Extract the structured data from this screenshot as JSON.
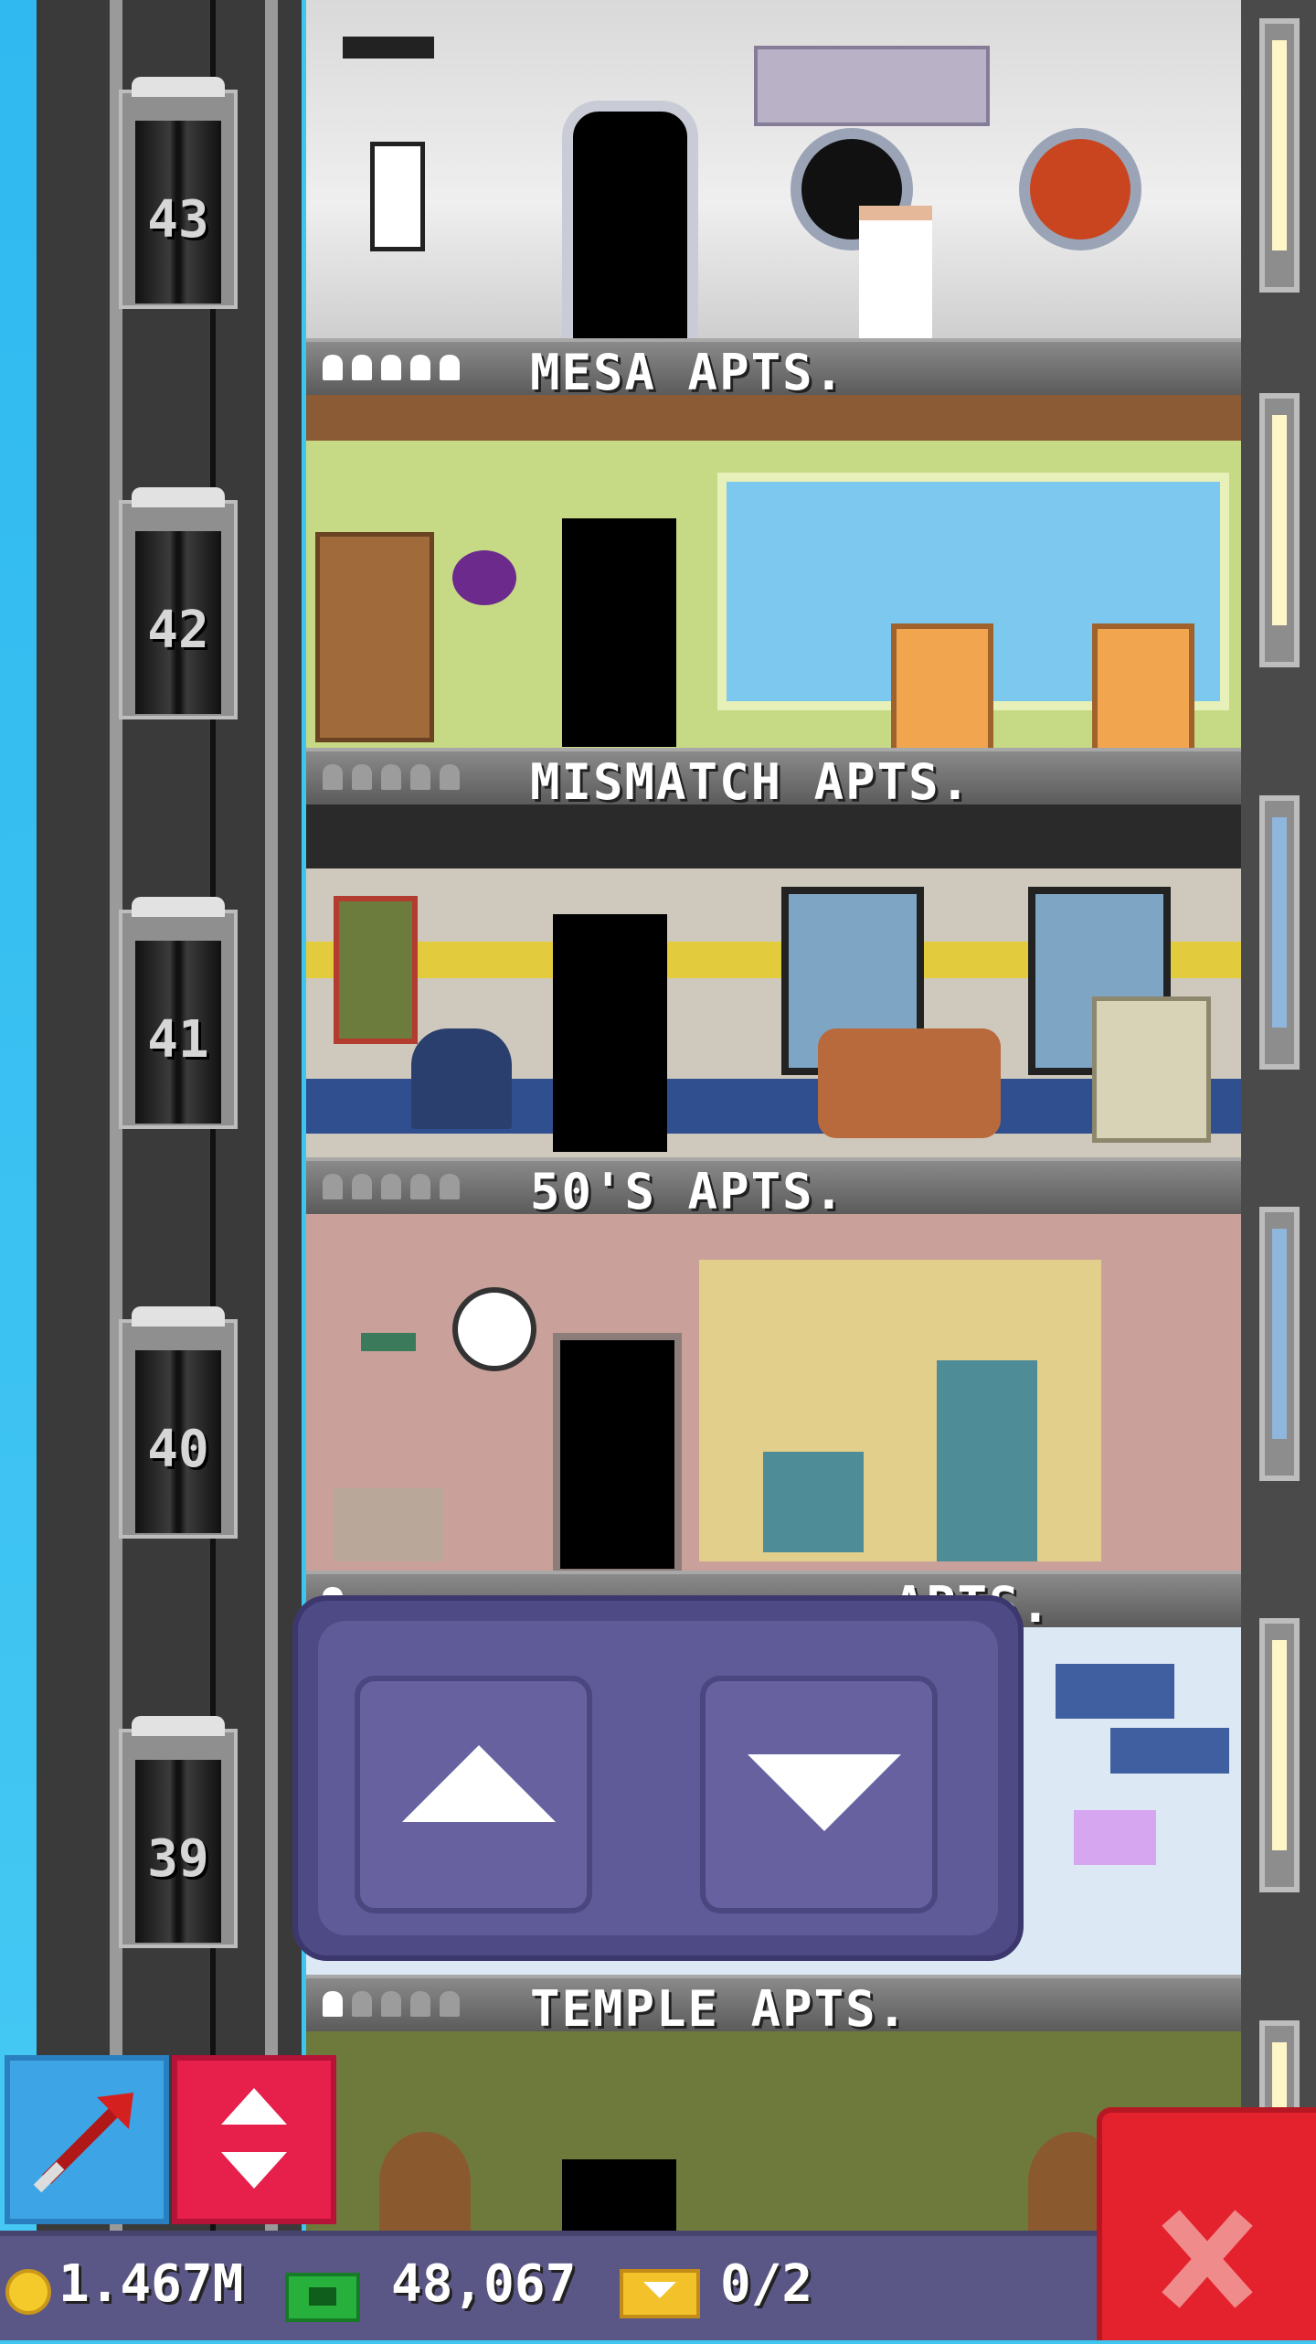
{
  "floors": [
    {
      "number": "43",
      "name": "MESA APTS.",
      "occupancy": 5
    },
    {
      "number": "42",
      "name": "MISMATCH APTS.",
      "occupancy": 0
    },
    {
      "number": "41",
      "name": "50'S APTS.",
      "occupancy": 0
    },
    {
      "number": "40",
      "name": "",
      "occupancy": 1
    },
    {
      "number": "39",
      "name": "TEMPLE APTS.",
      "occupancy": 1
    }
  ],
  "partial_floor_label": "...APTS.",
  "elevator_controls": {
    "up_icon": "arrow-up-icon",
    "down_icon": "arrow-down-icon"
  },
  "toolbar": {
    "left_icon": "diagonal-arrow-icon",
    "mid_icon": "up-down-arrows-icon",
    "close_icon": "close-x-icon"
  },
  "status": {
    "coins": "1.467M",
    "bux": "48,067",
    "tickets": "0/2"
  },
  "colors": {
    "accent_panel": "#5f5b98",
    "close_red": "#e4222e",
    "blue_button": "#3da5e6",
    "red_button": "#e61f4b"
  }
}
